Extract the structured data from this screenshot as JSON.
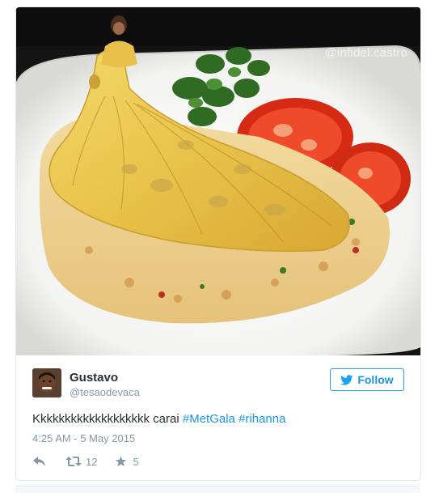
{
  "media": {
    "watermark": "@infidel.castro",
    "icon": "omelette-gown-meme-image"
  },
  "tweet": {
    "author_name": "Gustavo",
    "author_handle": "@tesaodevaca",
    "follow_label": "Follow",
    "text_plain": "Kkkkkkkkkkkkkkkkkkk carai ",
    "hashtags": [
      "#MetGala",
      "#rihanna"
    ],
    "timestamp": "4:25 AM - 5 May 2015",
    "retweets": "12",
    "likes": "5"
  },
  "colors": {
    "accent": "#1da1f2",
    "link": "#1b95e0",
    "muted": "#8899a6",
    "text": "#292f33",
    "border": "#e1e8ed"
  },
  "icons": {
    "follow": "bird-icon",
    "reply": "reply-icon",
    "retweet": "retweet-icon",
    "like": "star-icon"
  }
}
